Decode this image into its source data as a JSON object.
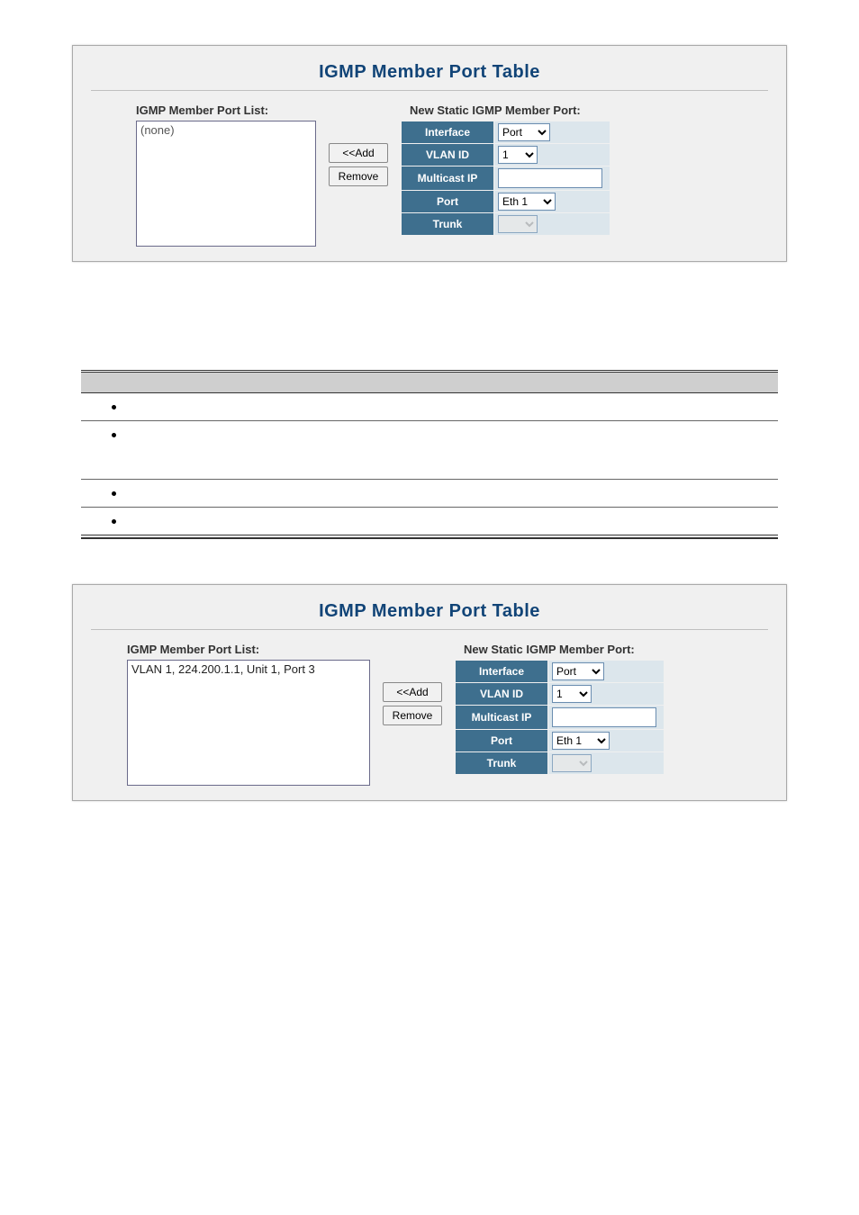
{
  "panel1": {
    "title": "IGMP Member Port Table",
    "list_label": "IGMP Member Port List:",
    "list_content": "(none)",
    "add_label": "<<Add",
    "remove_label": "Remove",
    "new_label": "New Static IGMP Member Port:",
    "rows": {
      "interface_label": "Interface",
      "interface_value": "Port",
      "vlan_label": "VLAN ID",
      "vlan_value": "1",
      "mcast_label": "Multicast IP",
      "mcast_value": "",
      "port_label": "Port",
      "port_value": "Eth 1",
      "trunk_label": "Trunk",
      "trunk_value": ""
    }
  },
  "panel2": {
    "title": "IGMP Member Port Table",
    "list_label": "IGMP Member Port List:",
    "list_content": "VLAN 1, 224.200.1.1, Unit 1, Port 3",
    "add_label": "<<Add",
    "remove_label": "Remove",
    "new_label": "New Static IGMP Member Port:",
    "rows": {
      "interface_label": "Interface",
      "interface_value": "Port",
      "vlan_label": "VLAN ID",
      "vlan_value": "1",
      "mcast_label": "Multicast IP",
      "mcast_value": "",
      "port_label": "Port",
      "port_value": "Eth 1",
      "trunk_label": "Trunk",
      "trunk_value": ""
    }
  }
}
